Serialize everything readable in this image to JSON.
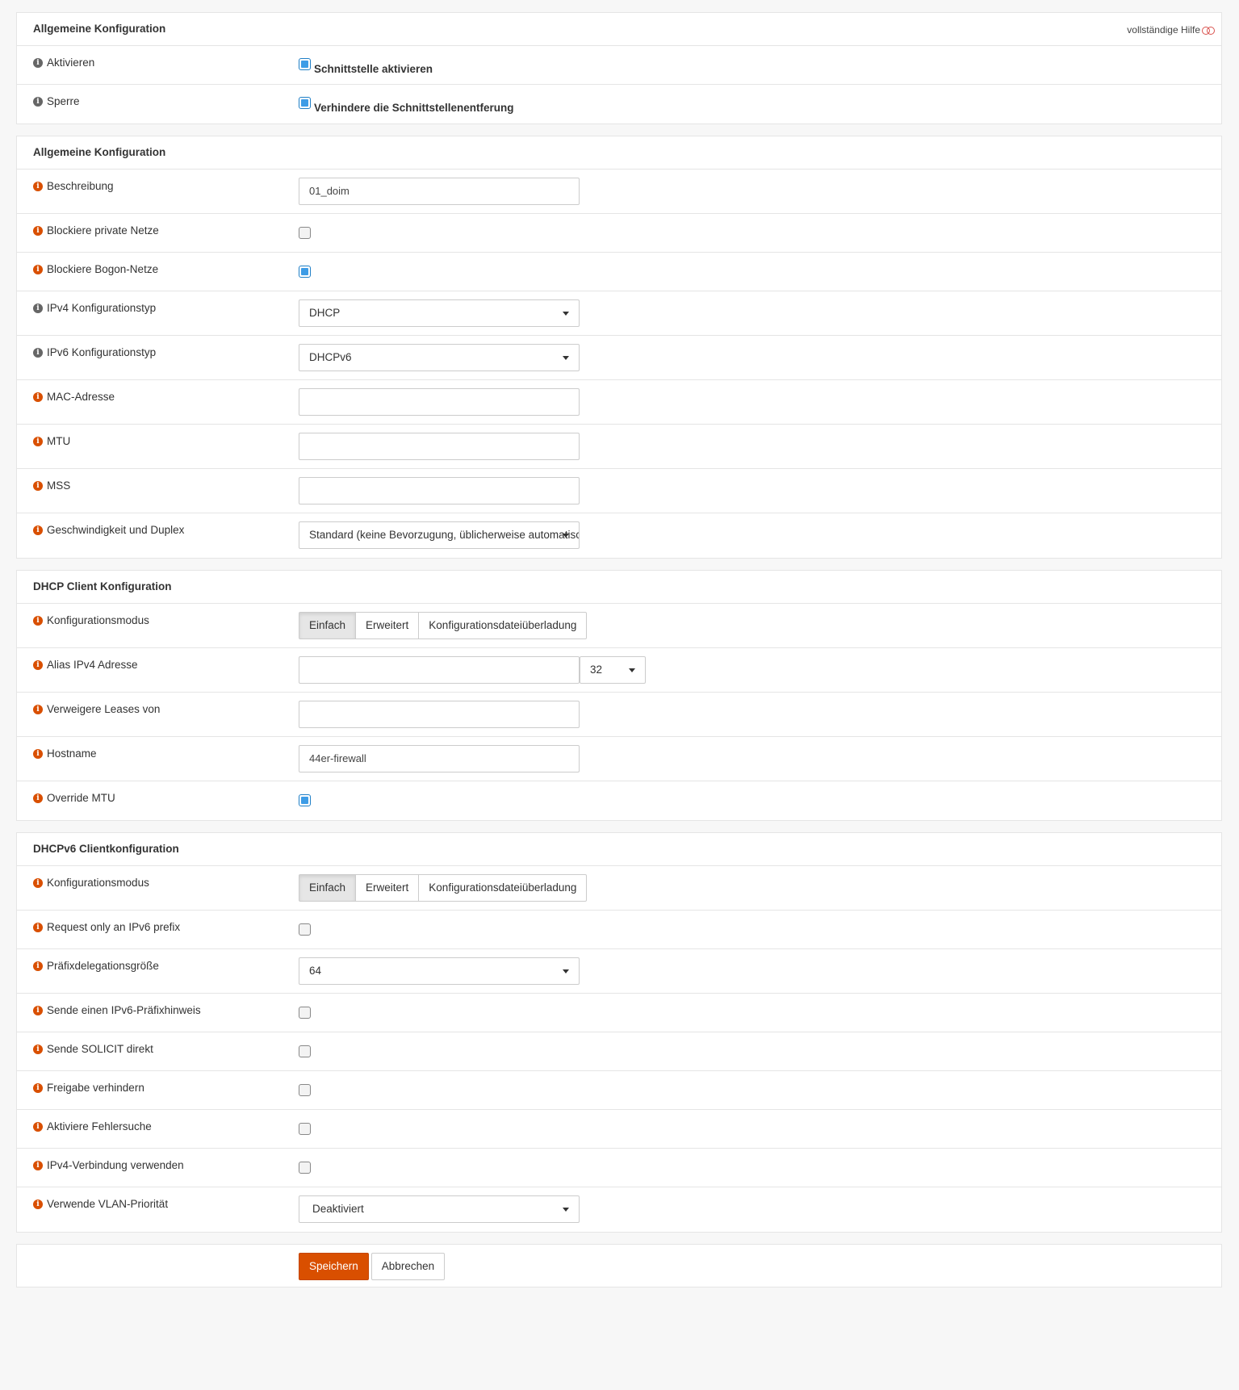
{
  "panel1": {
    "title": "Allgemeine Konfiguration",
    "help_label": "vollständige Hilfe",
    "rows": [
      {
        "label": "Aktivieren",
        "checkbox_label": "Schnittstelle aktivieren",
        "checked": true
      },
      {
        "label": "Sperre",
        "checkbox_label": "Verhindere die Schnittstellenentferung",
        "checked": true
      }
    ]
  },
  "panel2": {
    "title": "Allgemeine Konfiguration",
    "description": {
      "label": "Beschreibung",
      "value": "01_doim"
    },
    "block_private": {
      "label": "Blockiere private Netze",
      "checked": false
    },
    "block_bogon": {
      "label": "Blockiere Bogon-Netze",
      "checked": true
    },
    "ipv4_type": {
      "label": "IPv4 Konfigurationstyp",
      "value": "DHCP"
    },
    "ipv6_type": {
      "label": "IPv6 Konfigurationstyp",
      "value": "DHCPv6"
    },
    "mac": {
      "label": "MAC-Adresse",
      "value": ""
    },
    "mtu": {
      "label": "MTU",
      "value": ""
    },
    "mss": {
      "label": "MSS",
      "value": ""
    },
    "speed": {
      "label": "Geschwindigkeit und Duplex",
      "value": "Standard (keine Bevorzugung, üblicherweise automatisch)"
    }
  },
  "panel3": {
    "title": "DHCP Client Konfiguration",
    "mode": {
      "label": "Konfigurationsmodus",
      "options": [
        "Einfach",
        "Erweitert",
        "Konfigurationsdateiüberladung"
      ],
      "selected": "Einfach"
    },
    "alias": {
      "label": "Alias IPv4 Adresse",
      "value": "",
      "prefix": "32"
    },
    "reject": {
      "label": "Verweigere Leases von",
      "value": ""
    },
    "hostname": {
      "label": "Hostname",
      "value": "44er-firewall"
    },
    "override_mtu": {
      "label": "Override MTU",
      "checked": true
    }
  },
  "panel4": {
    "title": "DHCPv6 Clientkonfiguration",
    "mode": {
      "label": "Konfigurationsmodus",
      "options": [
        "Einfach",
        "Erweitert",
        "Konfigurationsdateiüberladung"
      ],
      "selected": "Einfach"
    },
    "request_prefix": {
      "label": "Request only an IPv6 prefix",
      "checked": false
    },
    "prefix_size": {
      "label": "Präfixdelegationsgröße",
      "value": "64"
    },
    "send_hint": {
      "label": "Sende einen IPv6-Präfixhinweis",
      "checked": false
    },
    "send_solicit": {
      "label": "Sende SOLICIT direkt",
      "checked": false
    },
    "prevent_release": {
      "label": "Freigabe verhindern",
      "checked": false
    },
    "debug": {
      "label": "Aktiviere Fehlersuche",
      "checked": false
    },
    "use_ipv4": {
      "label": "IPv4-Verbindung verwenden",
      "checked": false
    },
    "vlan_prio": {
      "label": "Verwende VLAN-Priorität",
      "value": "Deaktiviert"
    }
  },
  "actions": {
    "save": "Speichern",
    "cancel": "Abbrechen"
  },
  "colors": {
    "accent": "#d94f00",
    "checkbox_blue": "#3d9ce6"
  }
}
